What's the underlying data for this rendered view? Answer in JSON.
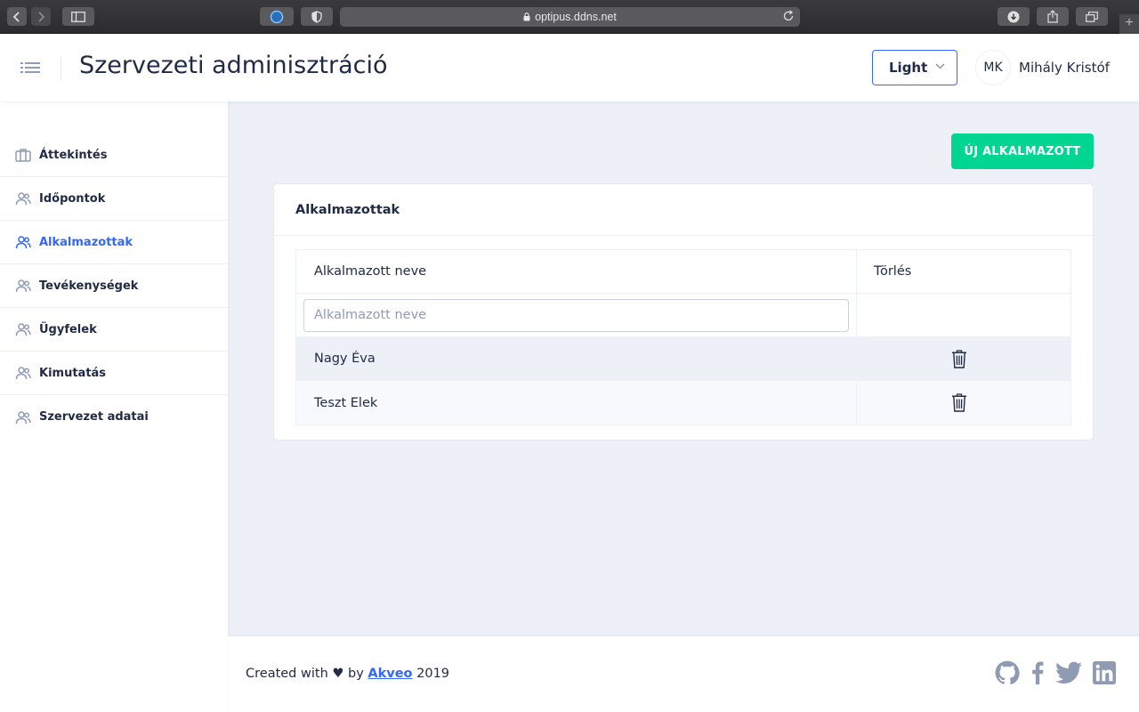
{
  "browser": {
    "url": "optipus.ddns.net"
  },
  "header": {
    "title": "Szervezeti adminisztráció",
    "theme_value": "Light",
    "user_initials": "MK",
    "user_name": "Mihály Kristóf"
  },
  "sidebar": {
    "items": [
      {
        "label": "Áttekintés",
        "icon": "briefcase-icon",
        "active": false
      },
      {
        "label": "Időpontok",
        "icon": "people-icon",
        "active": false
      },
      {
        "label": "Alkalmazottak",
        "icon": "people-icon",
        "active": true
      },
      {
        "label": "Tevékenységek",
        "icon": "people-icon",
        "active": false
      },
      {
        "label": "Ügyfelek",
        "icon": "people-icon",
        "active": false
      },
      {
        "label": "Kimutatás",
        "icon": "people-icon",
        "active": false
      },
      {
        "label": "Szervezet adatai",
        "icon": "people-icon",
        "active": false
      }
    ]
  },
  "main": {
    "new_button_label": "ÚJ ALKALMAZOTT",
    "card_title": "Alkalmazottak",
    "table": {
      "col_name": "Alkalmazott neve",
      "col_delete": "Törlés",
      "filter_placeholder": "Alkalmazott neve",
      "rows": [
        {
          "name": "Nagy Éva"
        },
        {
          "name": "Teszt Elek"
        }
      ]
    }
  },
  "footer": {
    "prefix": "Created with",
    "by": "by",
    "link": "Akveo",
    "year": "2019"
  },
  "colors": {
    "primary": "#3366ff",
    "success": "#00d68f",
    "background": "#edf1f7"
  }
}
